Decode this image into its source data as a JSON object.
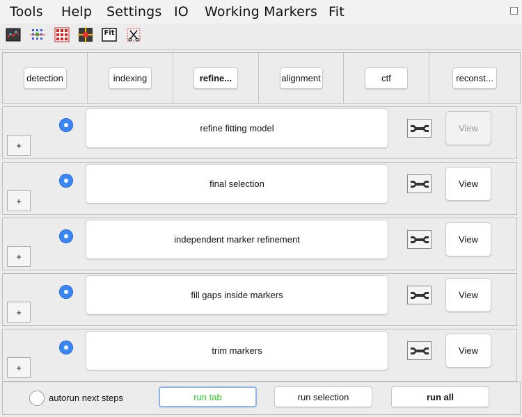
{
  "menu": [
    "Tools",
    "Help",
    "Settings",
    "IO",
    "Working Markers",
    "Fit"
  ],
  "toolbar_icons": [
    "image-view-icon",
    "marker-grid-icon",
    "red-grid-icon",
    "target-icon",
    "fit-icon",
    "cut-markers-icon"
  ],
  "toolbar_fit_text": "Fit",
  "tabs": [
    {
      "label": "detection",
      "active": false
    },
    {
      "label": "indexing",
      "active": false
    },
    {
      "label": "refine...",
      "active": true
    },
    {
      "label": "alignment",
      "active": false
    },
    {
      "label": "ctf",
      "active": false
    },
    {
      "label": "reconst...",
      "active": false
    }
  ],
  "steps": [
    {
      "expand_label": "+",
      "name": "refine fitting model",
      "view_label": "View",
      "view_enabled": false
    },
    {
      "expand_label": "+",
      "name": "final selection",
      "view_label": "View",
      "view_enabled": true
    },
    {
      "expand_label": "+",
      "name": "independent marker refinement",
      "view_label": "View",
      "view_enabled": true
    },
    {
      "expand_label": "+",
      "name": "fill gaps inside markers",
      "view_label": "View",
      "view_enabled": true
    },
    {
      "expand_label": "+",
      "name": "trim markers",
      "view_label": "View",
      "view_enabled": true
    }
  ],
  "bottom": {
    "autorun_label": "autorun next steps",
    "run_tab_label": "run tab",
    "run_selection_label": "run selection",
    "run_all_label": "run all"
  },
  "colors": {
    "radio_selected": "#3b86f7",
    "run_tab_text": "#2fc72f"
  }
}
